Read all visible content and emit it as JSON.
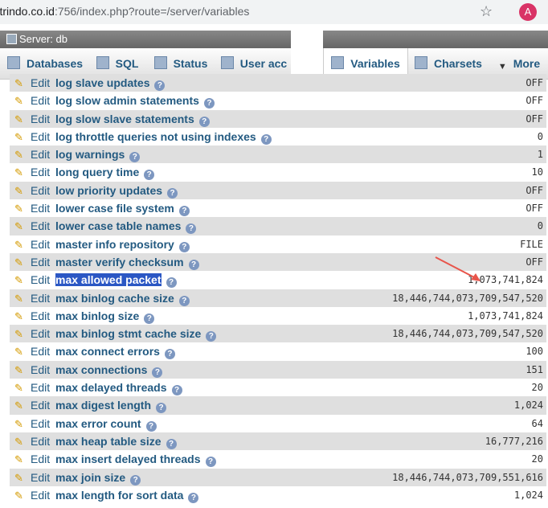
{
  "browser": {
    "url_host": "metrindo.co.id",
    "url_rest": ":756/index.php?route=/server/variables",
    "avatar_letter": "A"
  },
  "server": {
    "label": "Server: db"
  },
  "tabs": [
    {
      "label": "Databases",
      "icon": "database-icon"
    },
    {
      "label": "SQL",
      "icon": "sql-icon"
    },
    {
      "label": "Status",
      "icon": "status-chart-icon"
    },
    {
      "label": "User acc",
      "icon": "user-accounts-icon"
    },
    {
      "label": "Variables",
      "icon": "variables-icon",
      "active": true
    },
    {
      "label": "Charsets",
      "icon": "charsets-icon"
    },
    {
      "label": "More",
      "icon": "chevron-down-icon"
    }
  ],
  "edit_label": "Edit",
  "variables": [
    {
      "name": "log slave updates",
      "value": "OFF"
    },
    {
      "name": "log slow admin statements",
      "value": "OFF"
    },
    {
      "name": "log slow slave statements",
      "value": "OFF"
    },
    {
      "name": "log throttle queries not using indexes",
      "value": "0"
    },
    {
      "name": "log warnings",
      "value": "1"
    },
    {
      "name": "long query time",
      "value": "10"
    },
    {
      "name": "low priority updates",
      "value": "OFF"
    },
    {
      "name": "lower case file system",
      "value": "OFF"
    },
    {
      "name": "lower case table names",
      "value": "0"
    },
    {
      "name": "master info repository",
      "value": "FILE"
    },
    {
      "name": "master verify checksum",
      "value": "OFF"
    },
    {
      "name": "max allowed packet",
      "value": "1,073,741,824",
      "selected": true
    },
    {
      "name": "max binlog cache size",
      "value": "18,446,744,073,709,547,520"
    },
    {
      "name": "max binlog size",
      "value": "1,073,741,824"
    },
    {
      "name": "max binlog stmt cache size",
      "value": "18,446,744,073,709,547,520"
    },
    {
      "name": "max connect errors",
      "value": "100"
    },
    {
      "name": "max connections",
      "value": "151"
    },
    {
      "name": "max delayed threads",
      "value": "20"
    },
    {
      "name": "max digest length",
      "value": "1,024"
    },
    {
      "name": "max error count",
      "value": "64"
    },
    {
      "name": "max heap table size",
      "value": "16,777,216"
    },
    {
      "name": "max insert delayed threads",
      "value": "20"
    },
    {
      "name": "max join size",
      "value": "18,446,744,073,709,551,616"
    },
    {
      "name": "max length for sort data",
      "value": "1,024"
    }
  ]
}
